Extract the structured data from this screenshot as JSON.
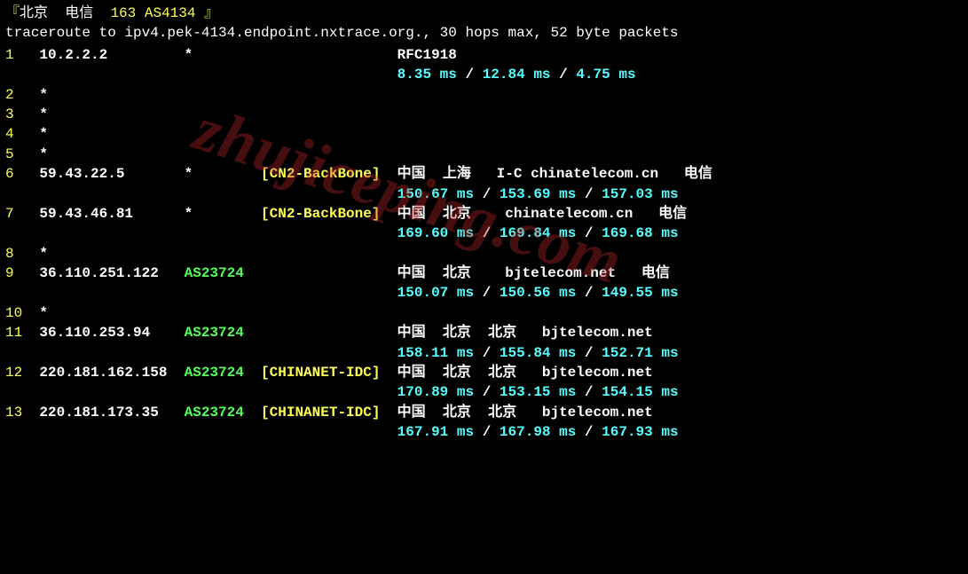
{
  "header": {
    "bracket_open": "『",
    "loc": "北京",
    "isp": "电信",
    "net": "163",
    "asn": "AS4134",
    "bracket_close": "』"
  },
  "command": "traceroute to ipv4.pek-4134.endpoint.nxtrace.org., 30 hops max, 52 byte packets",
  "watermark": "zhujiceping.com",
  "hops": [
    {
      "n": "1",
      "ip": "10.2.2.2",
      "asn": "*",
      "tag": "",
      "loc": "RFC1918",
      "rtt": [
        "8.35 ms",
        "12.84 ms",
        "4.75 ms"
      ]
    },
    {
      "n": "2",
      "ip": "*",
      "star": true
    },
    {
      "n": "3",
      "ip": "*",
      "star": true
    },
    {
      "n": "4",
      "ip": "*",
      "star": true
    },
    {
      "n": "5",
      "ip": "*",
      "star": true
    },
    {
      "n": "6",
      "ip": "59.43.22.5",
      "asn": "*",
      "tag": "[CN2-BackBone]",
      "loc": "中国  上海   I-C chinatelecom.cn   电信",
      "rtt": [
        "150.67 ms",
        "153.69 ms",
        "157.03 ms"
      ]
    },
    {
      "n": "7",
      "ip": "59.43.46.81",
      "asn": "*",
      "tag": "[CN2-BackBone]",
      "loc": "中国  北京    chinatelecom.cn   电信",
      "rtt": [
        "169.60 ms",
        "169.84 ms",
        "169.68 ms"
      ]
    },
    {
      "n": "8",
      "ip": "*",
      "star": true
    },
    {
      "n": "9",
      "ip": "36.110.251.122",
      "asn": "AS23724",
      "tag": "",
      "loc": "中国  北京    bjtelecom.net   电信",
      "rtt": [
        "150.07 ms",
        "150.56 ms",
        "149.55 ms"
      ]
    },
    {
      "n": "10",
      "ip": "*",
      "star": true
    },
    {
      "n": "11",
      "ip": "36.110.253.94",
      "asn": "AS23724",
      "tag": "",
      "loc": "中国  北京  北京   bjtelecom.net",
      "rtt": [
        "158.11 ms",
        "155.84 ms",
        "152.71 ms"
      ]
    },
    {
      "n": "12",
      "ip": "220.181.162.158",
      "asn": "AS23724",
      "tag": "[CHINANET-IDC]",
      "loc": "中国  北京  北京   bjtelecom.net",
      "rtt": [
        "170.89 ms",
        "153.15 ms",
        "154.15 ms"
      ]
    },
    {
      "n": "13",
      "ip": "220.181.173.35",
      "asn": "AS23724",
      "tag": "[CHINANET-IDC]",
      "loc": "中国  北京  北京   bjtelecom.net",
      "rtt": [
        "167.91 ms",
        "167.98 ms",
        "167.93 ms"
      ]
    }
  ]
}
